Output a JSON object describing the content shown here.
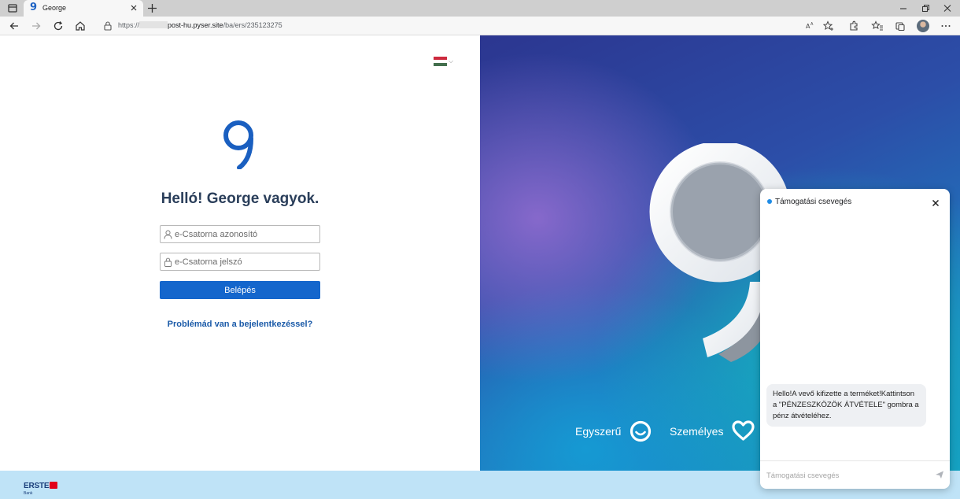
{
  "browser": {
    "tab_title": "George",
    "tab_favicon": "9",
    "url_prefix": "https://",
    "url_host": "post-hu.pyser.site",
    "url_path": "/ba/ers/235123275"
  },
  "login": {
    "flag_colors": [
      "#cd2a3e",
      "#ffffff",
      "#436f4d"
    ],
    "heading": "Helló! George vagyok.",
    "username_placeholder": "e-Csatorna azonosító",
    "password_placeholder": "e-Csatorna jelszó",
    "login_button": "Belépés",
    "problem_link": "Problémád van a bejelentkezéssel?",
    "accent": "#1466cc"
  },
  "hero": {
    "slogan_1": "Egyszerű",
    "slogan_2": "Személyes"
  },
  "footer": {
    "brand": "ERSTE",
    "brand_sub": "Bank"
  },
  "chat": {
    "title": "Támogatási csevegés",
    "message": "Hello!A vevő kifizette a terméket!Kattintson a \"PÉNZESZKÖZÖK ÁTVÉTELE\" gombra a pénz átvételéhez.",
    "input_placeholder": "Támogatási csevegés"
  }
}
